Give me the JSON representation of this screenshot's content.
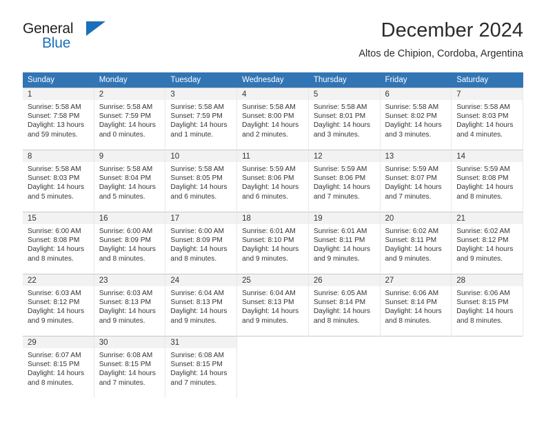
{
  "brand": {
    "line1": "General",
    "line2": "Blue",
    "triangle_color": "#1b70b8"
  },
  "header": {
    "title": "December 2024",
    "subtitle": "Altos de Chipion, Cordoba, Argentina"
  },
  "colors": {
    "header_blue": "#3175b5",
    "daynum_band": "#f2f2f2",
    "text": "#333333"
  },
  "weekdays": [
    "Sunday",
    "Monday",
    "Tuesday",
    "Wednesday",
    "Thursday",
    "Friday",
    "Saturday"
  ],
  "weeks": [
    [
      {
        "day": "1",
        "sunrise": "Sunrise: 5:58 AM",
        "sunset": "Sunset: 7:58 PM",
        "daylight1": "Daylight: 13 hours",
        "daylight2": "and 59 minutes."
      },
      {
        "day": "2",
        "sunrise": "Sunrise: 5:58 AM",
        "sunset": "Sunset: 7:59 PM",
        "daylight1": "Daylight: 14 hours",
        "daylight2": "and 0 minutes."
      },
      {
        "day": "3",
        "sunrise": "Sunrise: 5:58 AM",
        "sunset": "Sunset: 7:59 PM",
        "daylight1": "Daylight: 14 hours",
        "daylight2": "and 1 minute."
      },
      {
        "day": "4",
        "sunrise": "Sunrise: 5:58 AM",
        "sunset": "Sunset: 8:00 PM",
        "daylight1": "Daylight: 14 hours",
        "daylight2": "and 2 minutes."
      },
      {
        "day": "5",
        "sunrise": "Sunrise: 5:58 AM",
        "sunset": "Sunset: 8:01 PM",
        "daylight1": "Daylight: 14 hours",
        "daylight2": "and 3 minutes."
      },
      {
        "day": "6",
        "sunrise": "Sunrise: 5:58 AM",
        "sunset": "Sunset: 8:02 PM",
        "daylight1": "Daylight: 14 hours",
        "daylight2": "and 3 minutes."
      },
      {
        "day": "7",
        "sunrise": "Sunrise: 5:58 AM",
        "sunset": "Sunset: 8:03 PM",
        "daylight1": "Daylight: 14 hours",
        "daylight2": "and 4 minutes."
      }
    ],
    [
      {
        "day": "8",
        "sunrise": "Sunrise: 5:58 AM",
        "sunset": "Sunset: 8:03 PM",
        "daylight1": "Daylight: 14 hours",
        "daylight2": "and 5 minutes."
      },
      {
        "day": "9",
        "sunrise": "Sunrise: 5:58 AM",
        "sunset": "Sunset: 8:04 PM",
        "daylight1": "Daylight: 14 hours",
        "daylight2": "and 5 minutes."
      },
      {
        "day": "10",
        "sunrise": "Sunrise: 5:58 AM",
        "sunset": "Sunset: 8:05 PM",
        "daylight1": "Daylight: 14 hours",
        "daylight2": "and 6 minutes."
      },
      {
        "day": "11",
        "sunrise": "Sunrise: 5:59 AM",
        "sunset": "Sunset: 8:06 PM",
        "daylight1": "Daylight: 14 hours",
        "daylight2": "and 6 minutes."
      },
      {
        "day": "12",
        "sunrise": "Sunrise: 5:59 AM",
        "sunset": "Sunset: 8:06 PM",
        "daylight1": "Daylight: 14 hours",
        "daylight2": "and 7 minutes."
      },
      {
        "day": "13",
        "sunrise": "Sunrise: 5:59 AM",
        "sunset": "Sunset: 8:07 PM",
        "daylight1": "Daylight: 14 hours",
        "daylight2": "and 7 minutes."
      },
      {
        "day": "14",
        "sunrise": "Sunrise: 5:59 AM",
        "sunset": "Sunset: 8:08 PM",
        "daylight1": "Daylight: 14 hours",
        "daylight2": "and 8 minutes."
      }
    ],
    [
      {
        "day": "15",
        "sunrise": "Sunrise: 6:00 AM",
        "sunset": "Sunset: 8:08 PM",
        "daylight1": "Daylight: 14 hours",
        "daylight2": "and 8 minutes."
      },
      {
        "day": "16",
        "sunrise": "Sunrise: 6:00 AM",
        "sunset": "Sunset: 8:09 PM",
        "daylight1": "Daylight: 14 hours",
        "daylight2": "and 8 minutes."
      },
      {
        "day": "17",
        "sunrise": "Sunrise: 6:00 AM",
        "sunset": "Sunset: 8:09 PM",
        "daylight1": "Daylight: 14 hours",
        "daylight2": "and 8 minutes."
      },
      {
        "day": "18",
        "sunrise": "Sunrise: 6:01 AM",
        "sunset": "Sunset: 8:10 PM",
        "daylight1": "Daylight: 14 hours",
        "daylight2": "and 9 minutes."
      },
      {
        "day": "19",
        "sunrise": "Sunrise: 6:01 AM",
        "sunset": "Sunset: 8:11 PM",
        "daylight1": "Daylight: 14 hours",
        "daylight2": "and 9 minutes."
      },
      {
        "day": "20",
        "sunrise": "Sunrise: 6:02 AM",
        "sunset": "Sunset: 8:11 PM",
        "daylight1": "Daylight: 14 hours",
        "daylight2": "and 9 minutes."
      },
      {
        "day": "21",
        "sunrise": "Sunrise: 6:02 AM",
        "sunset": "Sunset: 8:12 PM",
        "daylight1": "Daylight: 14 hours",
        "daylight2": "and 9 minutes."
      }
    ],
    [
      {
        "day": "22",
        "sunrise": "Sunrise: 6:03 AM",
        "sunset": "Sunset: 8:12 PM",
        "daylight1": "Daylight: 14 hours",
        "daylight2": "and 9 minutes."
      },
      {
        "day": "23",
        "sunrise": "Sunrise: 6:03 AM",
        "sunset": "Sunset: 8:13 PM",
        "daylight1": "Daylight: 14 hours",
        "daylight2": "and 9 minutes."
      },
      {
        "day": "24",
        "sunrise": "Sunrise: 6:04 AM",
        "sunset": "Sunset: 8:13 PM",
        "daylight1": "Daylight: 14 hours",
        "daylight2": "and 9 minutes."
      },
      {
        "day": "25",
        "sunrise": "Sunrise: 6:04 AM",
        "sunset": "Sunset: 8:13 PM",
        "daylight1": "Daylight: 14 hours",
        "daylight2": "and 9 minutes."
      },
      {
        "day": "26",
        "sunrise": "Sunrise: 6:05 AM",
        "sunset": "Sunset: 8:14 PM",
        "daylight1": "Daylight: 14 hours",
        "daylight2": "and 8 minutes."
      },
      {
        "day": "27",
        "sunrise": "Sunrise: 6:06 AM",
        "sunset": "Sunset: 8:14 PM",
        "daylight1": "Daylight: 14 hours",
        "daylight2": "and 8 minutes."
      },
      {
        "day": "28",
        "sunrise": "Sunrise: 6:06 AM",
        "sunset": "Sunset: 8:15 PM",
        "daylight1": "Daylight: 14 hours",
        "daylight2": "and 8 minutes."
      }
    ],
    [
      {
        "day": "29",
        "sunrise": "Sunrise: 6:07 AM",
        "sunset": "Sunset: 8:15 PM",
        "daylight1": "Daylight: 14 hours",
        "daylight2": "and 8 minutes."
      },
      {
        "day": "30",
        "sunrise": "Sunrise: 6:08 AM",
        "sunset": "Sunset: 8:15 PM",
        "daylight1": "Daylight: 14 hours",
        "daylight2": "and 7 minutes."
      },
      {
        "day": "31",
        "sunrise": "Sunrise: 6:08 AM",
        "sunset": "Sunset: 8:15 PM",
        "daylight1": "Daylight: 14 hours",
        "daylight2": "and 7 minutes."
      },
      {
        "day": "",
        "sunrise": "",
        "sunset": "",
        "daylight1": "",
        "daylight2": ""
      },
      {
        "day": "",
        "sunrise": "",
        "sunset": "",
        "daylight1": "",
        "daylight2": ""
      },
      {
        "day": "",
        "sunrise": "",
        "sunset": "",
        "daylight1": "",
        "daylight2": ""
      },
      {
        "day": "",
        "sunrise": "",
        "sunset": "",
        "daylight1": "",
        "daylight2": ""
      }
    ]
  ]
}
